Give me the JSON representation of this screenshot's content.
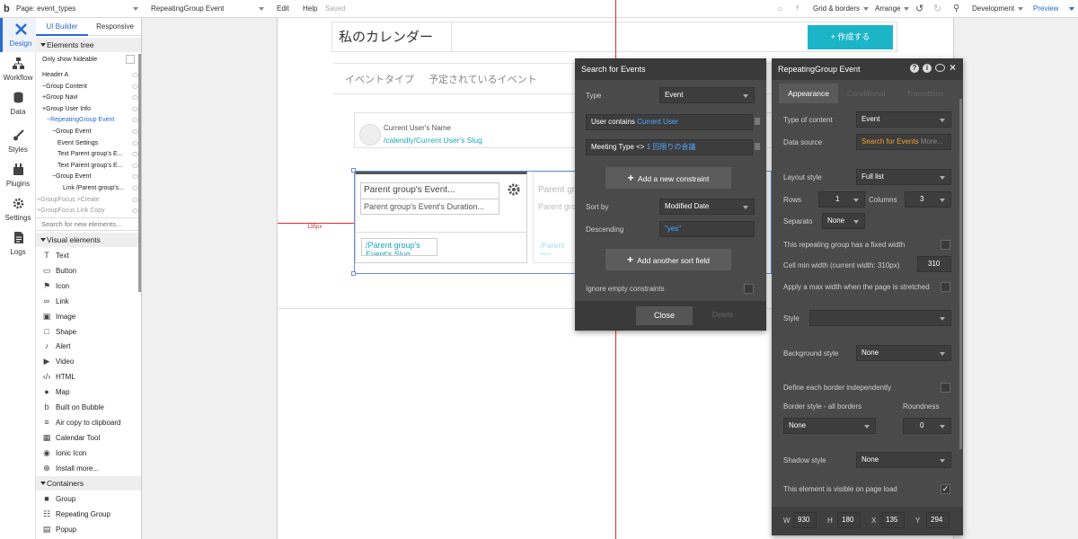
{
  "topbar": {
    "logo": "b",
    "page_label": "Page: event_types",
    "element_select": "RepeatingGroup Event",
    "edit": "Edit",
    "help": "Help",
    "saved": "Saved",
    "grid": "Grid & borders",
    "arrange": "Arrange",
    "development": "Development",
    "preview": "Preview"
  },
  "rail": [
    {
      "label": "Design",
      "icon": "design-icon"
    },
    {
      "label": "Workflow",
      "icon": "workflow-icon"
    },
    {
      "label": "Data",
      "icon": "data-icon"
    },
    {
      "label": "Styles",
      "icon": "styles-icon"
    },
    {
      "label": "Plugins",
      "icon": "plugins-icon"
    },
    {
      "label": "Settings",
      "icon": "settings-icon"
    },
    {
      "label": "Logs",
      "icon": "logs-icon"
    }
  ],
  "panel": {
    "tab_builder": "UI Builder",
    "tab_responsive": "Responsive",
    "elements_tree": "Elements tree",
    "only_hideable": "Only show hideable",
    "tree": [
      "Header A",
      "−Group Content",
      "+Group Navi",
      "+Group User Info",
      "−RepeatingGroup Event",
      "−Group Event",
      "Event Settings",
      "Text Parent group's E...",
      "Text Parent group's E...",
      "−Group Event",
      "Link /Parent group's...",
      "+GroupFocus >Create",
      "+GroupFocus Link Copy"
    ],
    "search_placeholder": "Search for new elements...",
    "visual_elements": "Visual elements",
    "visual": [
      {
        "label": "Text",
        "icon": "text-icon"
      },
      {
        "label": "Button",
        "icon": "button-icon"
      },
      {
        "label": "Icon",
        "icon": "flag-icon"
      },
      {
        "label": "Link",
        "icon": "link-icon"
      },
      {
        "label": "Image",
        "icon": "image-icon"
      },
      {
        "label": "Shape",
        "icon": "shape-icon"
      },
      {
        "label": "Alert",
        "icon": "bell-icon"
      },
      {
        "label": "Video",
        "icon": "video-icon"
      },
      {
        "label": "HTML",
        "icon": "code-icon"
      },
      {
        "label": "Map",
        "icon": "map-pin-icon"
      },
      {
        "label": "Built on Bubble",
        "icon": "bubble-icon"
      },
      {
        "label": "Air copy to clipboard",
        "icon": "clipboard-icon"
      },
      {
        "label": "Calendar Tool",
        "icon": "calendar-icon"
      },
      {
        "label": "Ionic Icon",
        "icon": "ionic-icon"
      },
      {
        "label": "Install more...",
        "icon": "plus-circle-icon"
      }
    ],
    "containers": "Containers",
    "container_items": [
      {
        "label": "Group",
        "icon": "folder-icon"
      },
      {
        "label": "Repeating Group",
        "icon": "repeating-group-icon"
      },
      {
        "label": "Popup",
        "icon": "popup-icon"
      }
    ]
  },
  "page": {
    "title": "私のカレンダー",
    "create_button": "+ 作成する",
    "tab1": "イベントタイプ",
    "tab2": "予定されているイベント",
    "user_name": "Current User's Name",
    "user_slug": "/calendly/Current User's Slug",
    "card_title": "Parent group's Event...",
    "card_duration": "Parent group's Event's Duration...",
    "card_link": "/Parent group's Event's Slug",
    "ghost_title": "Parent gro",
    "ghost_duration": "Parent gro",
    "ghost_link": "/Parent gro Event's Slu",
    "ruler_label": "135px"
  },
  "search": {
    "title": "Search for Events",
    "type_label": "Type",
    "type_value": "Event",
    "c1_key": "User contains",
    "c1_val": "Current User",
    "c2_key": "Meeting Type <>",
    "c2_val": "1 回限りの会議",
    "add_constraint": "Add a new constraint",
    "sort_label": "Sort by",
    "sort_value": "Modified Date",
    "desc_label": "Descending",
    "desc_value": "\"yes\"",
    "add_sort": "Add another sort field",
    "ignore_empty": "Ignore empty constraints",
    "close": "Close",
    "delete": "Delete"
  },
  "props": {
    "title": "RepeatingGroup Event",
    "tab_appearance": "Appearance",
    "tab_conditional": "Conditional",
    "tab_transitions": "Transitions",
    "type_content_label": "Type of content",
    "type_content_value": "Event",
    "data_source_label": "Data source",
    "data_source_value": "Search for Events",
    "data_source_more": "More...",
    "layout_label": "Layout style",
    "layout_value": "Full list",
    "rows_label": "Rows",
    "rows_value": "1",
    "columns_label": "Columns",
    "columns_value": "3",
    "separator_label": "Separato",
    "separator_value": "None",
    "fixed_width": "This repeating group has a fixed width",
    "min_width_label": "Cell min width (current width: 310px)",
    "min_width_value": "310",
    "max_width": "Apply a max width when the page is stretched",
    "style_label": "Style",
    "bg_label": "Background style",
    "bg_value": "None",
    "border_indep": "Define each border independently",
    "border_label": "Border style - all borders",
    "roundness_label": "Roundness",
    "border_value": "None",
    "roundness_value": "0",
    "shadow_label": "Shadow style",
    "shadow_value": "None",
    "visible_label": "This element is visible on page load",
    "w_label": "W",
    "w_value": "930",
    "h_label": "H",
    "h_value": "180",
    "x_label": "X",
    "x_value": "135",
    "y_label": "Y",
    "y_value": "294"
  },
  "colors": {
    "accent": "#2b6ad0",
    "teal": "#1aa5c0",
    "create_btn": "#1cb5c8",
    "orange": "#f0a030",
    "guide_red": "#d23030"
  }
}
